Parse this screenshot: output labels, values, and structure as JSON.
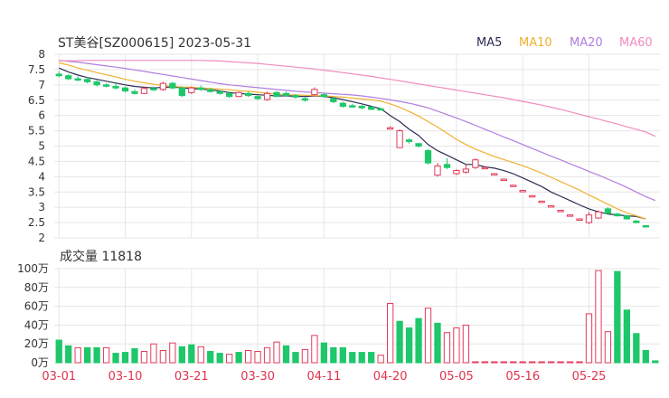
{
  "header": {
    "title": "ST美谷[SZ000615] 2023-05-31",
    "legend": [
      {
        "label": "MA5",
        "color": "#2c2c54"
      },
      {
        "label": "MA10",
        "color": "#f0b030"
      },
      {
        "label": "MA20",
        "color": "#b07ee0"
      },
      {
        "label": "MA60",
        "color": "#f08cc0"
      }
    ]
  },
  "colors": {
    "up": "#e23a5a",
    "down": "#1ec76a",
    "grid": "#e6e6e6",
    "axis": "#333333",
    "date": "#e0334d"
  },
  "chart_data": [
    {
      "type": "candlestick",
      "title": "ST美谷[SZ000615] 2023-05-31",
      "ylim": [
        2,
        8
      ],
      "yticks": [
        "2",
        "2.5",
        "3",
        "3.5",
        "4",
        "4.5",
        "5",
        "5.5",
        "6",
        "6.5",
        "7",
        "7.5",
        "8"
      ],
      "xticks": [
        {
          "label": "03-01",
          "index": 0
        },
        {
          "label": "03-10",
          "index": 7
        },
        {
          "label": "03-21",
          "index": 14
        },
        {
          "label": "03-30",
          "index": 21
        },
        {
          "label": "04-11",
          "index": 28
        },
        {
          "label": "04-20",
          "index": 35
        },
        {
          "label": "05-05",
          "index": 42
        },
        {
          "label": "05-16",
          "index": 49
        },
        {
          "label": "05-25",
          "index": 56
        }
      ],
      "candles": [
        [
          7.35,
          7.45,
          7.25,
          7.3
        ],
        [
          7.3,
          7.35,
          7.15,
          7.2
        ],
        [
          7.2,
          7.28,
          7.12,
          7.18
        ],
        [
          7.18,
          7.25,
          7.05,
          7.1
        ],
        [
          7.1,
          7.15,
          6.95,
          7.0
        ],
        [
          7.0,
          7.05,
          6.92,
          6.98
        ],
        [
          6.95,
          7.05,
          6.85,
          6.9
        ],
        [
          6.9,
          6.95,
          6.75,
          6.8
        ],
        [
          6.78,
          6.85,
          6.68,
          6.72
        ],
        [
          6.72,
          6.95,
          6.7,
          6.88
        ],
        [
          6.88,
          6.95,
          6.8,
          6.85
        ],
        [
          6.85,
          7.1,
          6.8,
          7.05
        ],
        [
          7.05,
          7.1,
          6.85,
          6.9
        ],
        [
          6.9,
          6.95,
          6.6,
          6.65
        ],
        [
          6.75,
          6.95,
          6.7,
          6.9
        ],
        [
          6.9,
          6.98,
          6.8,
          6.85
        ],
        [
          6.85,
          6.9,
          6.75,
          6.78
        ],
        [
          6.78,
          6.82,
          6.68,
          6.72
        ],
        [
          6.72,
          6.78,
          6.58,
          6.62
        ],
        [
          6.62,
          6.78,
          6.6,
          6.75
        ],
        [
          6.72,
          6.78,
          6.6,
          6.65
        ],
        [
          6.62,
          6.66,
          6.5,
          6.55
        ],
        [
          6.52,
          6.78,
          6.48,
          6.72
        ],
        [
          6.75,
          6.8,
          6.6,
          6.62
        ],
        [
          6.72,
          6.78,
          6.62,
          6.65
        ],
        [
          6.65,
          6.7,
          6.55,
          6.6
        ],
        [
          6.55,
          6.6,
          6.45,
          6.5
        ],
        [
          6.68,
          6.92,
          6.65,
          6.85
        ],
        [
          6.68,
          6.72,
          6.58,
          6.62
        ],
        [
          6.55,
          6.6,
          6.4,
          6.45
        ],
        [
          6.4,
          6.45,
          6.25,
          6.3
        ],
        [
          6.32,
          6.38,
          6.25,
          6.3
        ],
        [
          6.3,
          6.35,
          6.2,
          6.25
        ],
        [
          6.28,
          6.3,
          6.18,
          6.2
        ],
        [
          6.22,
          6.25,
          6.18,
          6.2
        ],
        [
          5.6,
          5.65,
          5.58,
          5.6
        ],
        [
          4.95,
          5.55,
          4.95,
          5.5
        ],
        [
          5.2,
          5.25,
          5.08,
          5.15
        ],
        [
          5.08,
          5.1,
          4.95,
          5.0
        ],
        [
          4.85,
          4.9,
          4.4,
          4.45
        ],
        [
          4.05,
          4.45,
          4.0,
          4.35
        ],
        [
          4.4,
          4.6,
          4.25,
          4.3
        ],
        [
          4.1,
          4.25,
          4.05,
          4.2
        ],
        [
          4.15,
          4.4,
          4.1,
          4.25
        ],
        [
          4.3,
          4.6,
          4.25,
          4.55
        ],
        [
          4.3,
          4.32,
          4.28,
          4.3
        ],
        [
          4.1,
          4.12,
          4.08,
          4.1
        ],
        [
          3.92,
          3.94,
          3.9,
          3.92
        ],
        [
          3.72,
          3.74,
          3.7,
          3.72
        ],
        [
          3.55,
          3.57,
          3.53,
          3.55
        ],
        [
          3.38,
          3.4,
          3.36,
          3.38
        ],
        [
          3.2,
          3.22,
          3.18,
          3.2
        ],
        [
          3.05,
          3.07,
          3.03,
          3.05
        ],
        [
          2.9,
          2.92,
          2.88,
          2.9
        ],
        [
          2.75,
          2.77,
          2.73,
          2.75
        ],
        [
          2.62,
          2.64,
          2.6,
          2.62
        ],
        [
          2.5,
          2.85,
          2.45,
          2.75
        ],
        [
          2.65,
          2.9,
          2.62,
          2.85
        ],
        [
          2.95,
          3.0,
          2.8,
          2.8
        ],
        [
          2.78,
          2.82,
          2.7,
          2.72
        ],
        [
          2.72,
          2.75,
          2.6,
          2.62
        ],
        [
          2.55,
          2.58,
          2.48,
          2.5
        ],
        [
          2.4,
          2.42,
          2.36,
          2.38
        ]
      ],
      "series": [
        {
          "name": "MA5",
          "values": [
            7.55,
            7.42,
            7.32,
            7.24,
            7.18,
            7.12,
            7.06,
            7.0,
            6.95,
            6.92,
            6.9,
            6.92,
            6.93,
            6.9,
            6.88,
            6.86,
            6.84,
            6.8,
            6.75,
            6.72,
            6.7,
            6.68,
            6.66,
            6.64,
            6.64,
            6.63,
            6.62,
            6.64,
            6.62,
            6.58,
            6.52,
            6.45,
            6.38,
            6.3,
            6.22,
            6.0,
            5.8,
            5.55,
            5.35,
            5.05,
            4.85,
            4.7,
            4.55,
            4.4,
            4.4,
            4.32,
            4.28,
            4.2,
            4.1,
            3.96,
            3.82,
            3.68,
            3.5,
            3.36,
            3.22,
            3.08,
            2.95,
            2.85,
            2.78,
            2.75,
            2.72,
            2.7,
            2.62
          ]
        },
        {
          "name": "MA10",
          "values": [
            7.72,
            7.65,
            7.55,
            7.48,
            7.4,
            7.33,
            7.26,
            7.18,
            7.12,
            7.07,
            7.02,
            6.98,
            6.95,
            6.93,
            6.92,
            6.9,
            6.88,
            6.86,
            6.84,
            6.81,
            6.79,
            6.76,
            6.73,
            6.7,
            6.68,
            6.67,
            6.66,
            6.65,
            6.64,
            6.62,
            6.6,
            6.57,
            6.54,
            6.51,
            6.47,
            6.38,
            6.27,
            6.13,
            5.98,
            5.8,
            5.62,
            5.42,
            5.22,
            5.05,
            4.9,
            4.78,
            4.66,
            4.56,
            4.46,
            4.36,
            4.24,
            4.12,
            3.98,
            3.84,
            3.7,
            3.56,
            3.4,
            3.25,
            3.1,
            2.95,
            2.82,
            2.72,
            2.62
          ]
        },
        {
          "name": "MA20",
          "values": [
            7.8,
            7.77,
            7.74,
            7.7,
            7.66,
            7.62,
            7.58,
            7.54,
            7.49,
            7.44,
            7.39,
            7.34,
            7.29,
            7.24,
            7.19,
            7.14,
            7.09,
            7.04,
            7.0,
            6.97,
            6.94,
            6.91,
            6.88,
            6.85,
            6.82,
            6.79,
            6.77,
            6.75,
            6.73,
            6.71,
            6.69,
            6.67,
            6.64,
            6.6,
            6.56,
            6.51,
            6.46,
            6.4,
            6.33,
            6.25,
            6.14,
            6.03,
            5.92,
            5.8,
            5.68,
            5.55,
            5.43,
            5.3,
            5.18,
            5.05,
            4.92,
            4.8,
            4.67,
            4.55,
            4.42,
            4.3,
            4.17,
            4.05,
            3.92,
            3.79,
            3.65,
            3.5,
            3.35,
            3.22
          ]
        },
        {
          "name": "MA60",
          "values": [
            7.78,
            7.79,
            7.79,
            7.8,
            7.8,
            7.8,
            7.8,
            7.8,
            7.8,
            7.8,
            7.8,
            7.8,
            7.8,
            7.8,
            7.8,
            7.8,
            7.79,
            7.78,
            7.76,
            7.74,
            7.72,
            7.7,
            7.67,
            7.64,
            7.61,
            7.58,
            7.55,
            7.52,
            7.48,
            7.44,
            7.4,
            7.36,
            7.32,
            7.28,
            7.23,
            7.18,
            7.13,
            7.08,
            7.03,
            6.98,
            6.93,
            6.88,
            6.83,
            6.78,
            6.73,
            6.68,
            6.63,
            6.58,
            6.52,
            6.46,
            6.4,
            6.34,
            6.27,
            6.2,
            6.12,
            6.04,
            5.96,
            5.88,
            5.8,
            5.72,
            5.63,
            5.55,
            5.46,
            5.32
          ]
        }
      ]
    },
    {
      "type": "bar",
      "title": "成交量 11818",
      "ylim": [
        0,
        100
      ],
      "yticks": [
        "0万",
        "20万",
        "40万",
        "60万",
        "80万",
        "100万"
      ],
      "values": [
        24,
        18,
        16,
        16,
        16,
        16,
        10,
        11,
        15,
        12,
        20,
        13,
        21,
        17,
        19,
        17,
        12,
        10,
        9,
        11,
        13,
        12,
        16,
        22,
        18,
        11,
        14,
        29,
        21,
        16,
        16,
        11,
        11,
        11,
        8,
        63,
        44,
        37,
        47,
        58,
        42,
        32,
        37,
        40,
        1,
        1,
        1,
        1,
        1,
        1,
        1,
        1,
        1,
        1,
        1,
        1,
        52,
        98,
        33,
        97,
        56,
        31,
        13,
        2
      ],
      "up": [
        false,
        false,
        true,
        false,
        false,
        true,
        false,
        false,
        false,
        true,
        true,
        true,
        true,
        false,
        false,
        true,
        false,
        false,
        true,
        false,
        true,
        true,
        true,
        true,
        false,
        false,
        true,
        true,
        false,
        false,
        false,
        false,
        false,
        false,
        true,
        true,
        false,
        false,
        false,
        true,
        false,
        true,
        true,
        true,
        true,
        true,
        true,
        true,
        true,
        true,
        true,
        true,
        true,
        true,
        true,
        true,
        true,
        true,
        true,
        false,
        false,
        false,
        false,
        false
      ]
    }
  ],
  "footer_label": "成交量 11818"
}
